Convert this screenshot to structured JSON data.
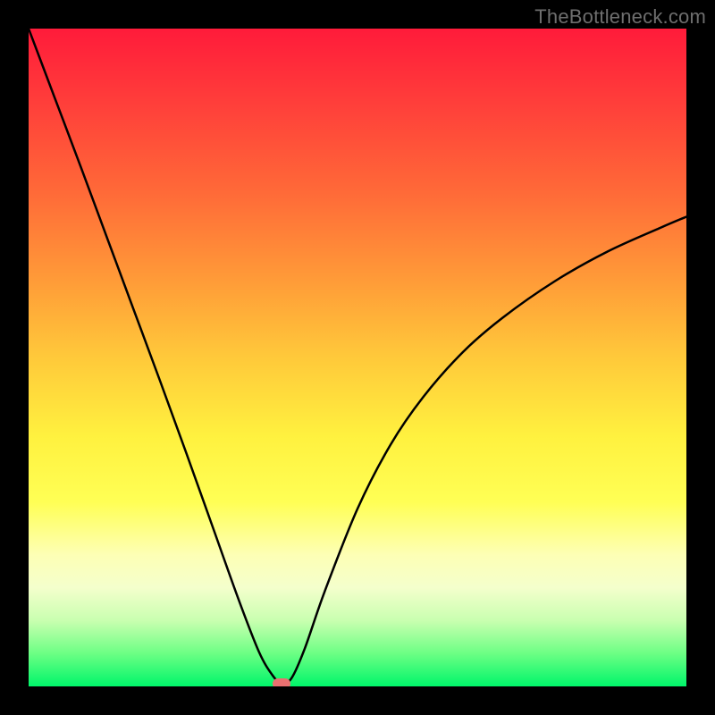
{
  "watermark": "TheBottleneck.com",
  "colors": {
    "curve": "#000000",
    "marker": "#e97070",
    "frame": "#000000"
  },
  "chart_data": {
    "type": "line",
    "title": "",
    "xlabel": "",
    "ylabel": "",
    "xlim": [
      0,
      100
    ],
    "ylim": [
      0,
      100
    ],
    "grid": false,
    "legend": false,
    "series": [
      {
        "name": "curve",
        "x": [
          0,
          4,
          8,
          12,
          16,
          20,
          24,
          28,
          32,
          35,
          37,
          38.5,
          40,
          42,
          45,
          50,
          55,
          60,
          66,
          72,
          80,
          88,
          96,
          100
        ],
        "y": [
          100,
          89.4,
          78.8,
          68.0,
          57.2,
          46.4,
          35.4,
          24.2,
          13.0,
          5.3,
          1.8,
          0.4,
          1.3,
          5.8,
          14.4,
          27.0,
          36.7,
          44.0,
          50.8,
          56.0,
          61.6,
          66.1,
          69.7,
          71.4
        ]
      }
    ],
    "marker": {
      "x": 38.5,
      "y": 0.4
    },
    "background_gradient": {
      "direction": "vertical",
      "stops": [
        {
          "pos": 0.0,
          "color": "#ff1b3a"
        },
        {
          "pos": 0.5,
          "color": "#ffc93a"
        },
        {
          "pos": 0.8,
          "color": "#fdffb5"
        },
        {
          "pos": 1.0,
          "color": "#00f56a"
        }
      ]
    }
  }
}
